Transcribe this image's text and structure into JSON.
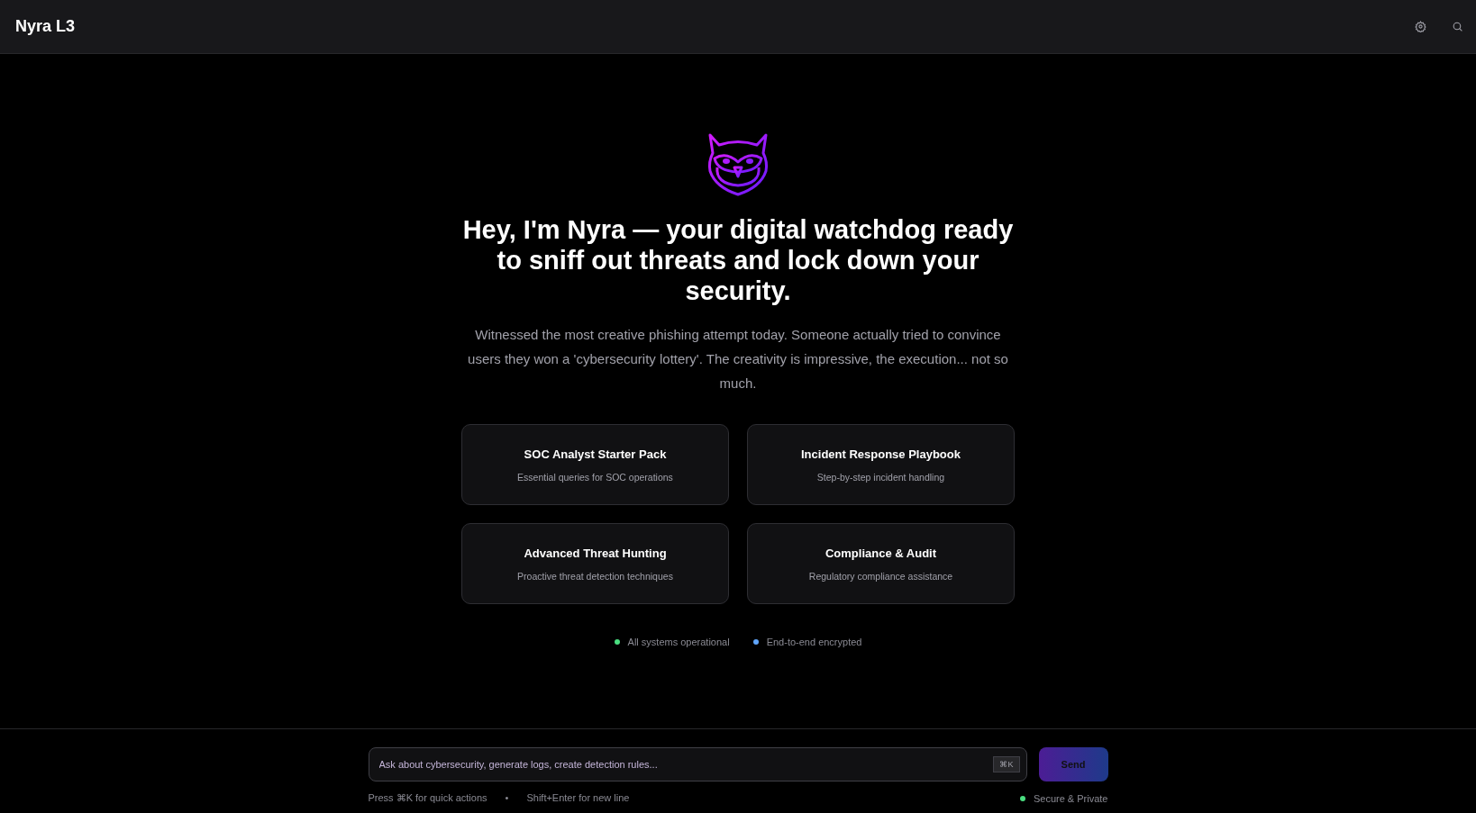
{
  "header": {
    "title": "Nyra L3"
  },
  "hero": {
    "heading": "Hey, I'm Nyra — your digital watchdog ready to sniff out threats and lock down your security.",
    "subtitle": "Witnessed the most creative phishing attempt today. Someone actually tried to convince users they won a 'cybersecurity lottery'. The creativity is impressive, the execution... not so much."
  },
  "cards": [
    {
      "title": "SOC Analyst Starter Pack",
      "description": "Essential queries for SOC operations"
    },
    {
      "title": "Incident Response Playbook",
      "description": "Step-by-step incident handling"
    },
    {
      "title": "Advanced Threat Hunting",
      "description": "Proactive threat detection techniques"
    },
    {
      "title": "Compliance & Audit",
      "description": "Regulatory compliance assistance"
    }
  ],
  "status": [
    {
      "label": "All systems operational",
      "color": "#4ade80"
    },
    {
      "label": "End-to-end encrypted",
      "color": "#60a5fa"
    }
  ],
  "composer": {
    "placeholder": "Ask about cybersecurity, generate logs, create detection rules...",
    "shortcut": "⌘K",
    "send": "Send"
  },
  "footer": {
    "hints": [
      "Press ⌘K for quick actions",
      "•",
      "Shift+Enter for new line"
    ],
    "secure": {
      "label": "Secure & Private",
      "color": "#4ade80"
    }
  }
}
